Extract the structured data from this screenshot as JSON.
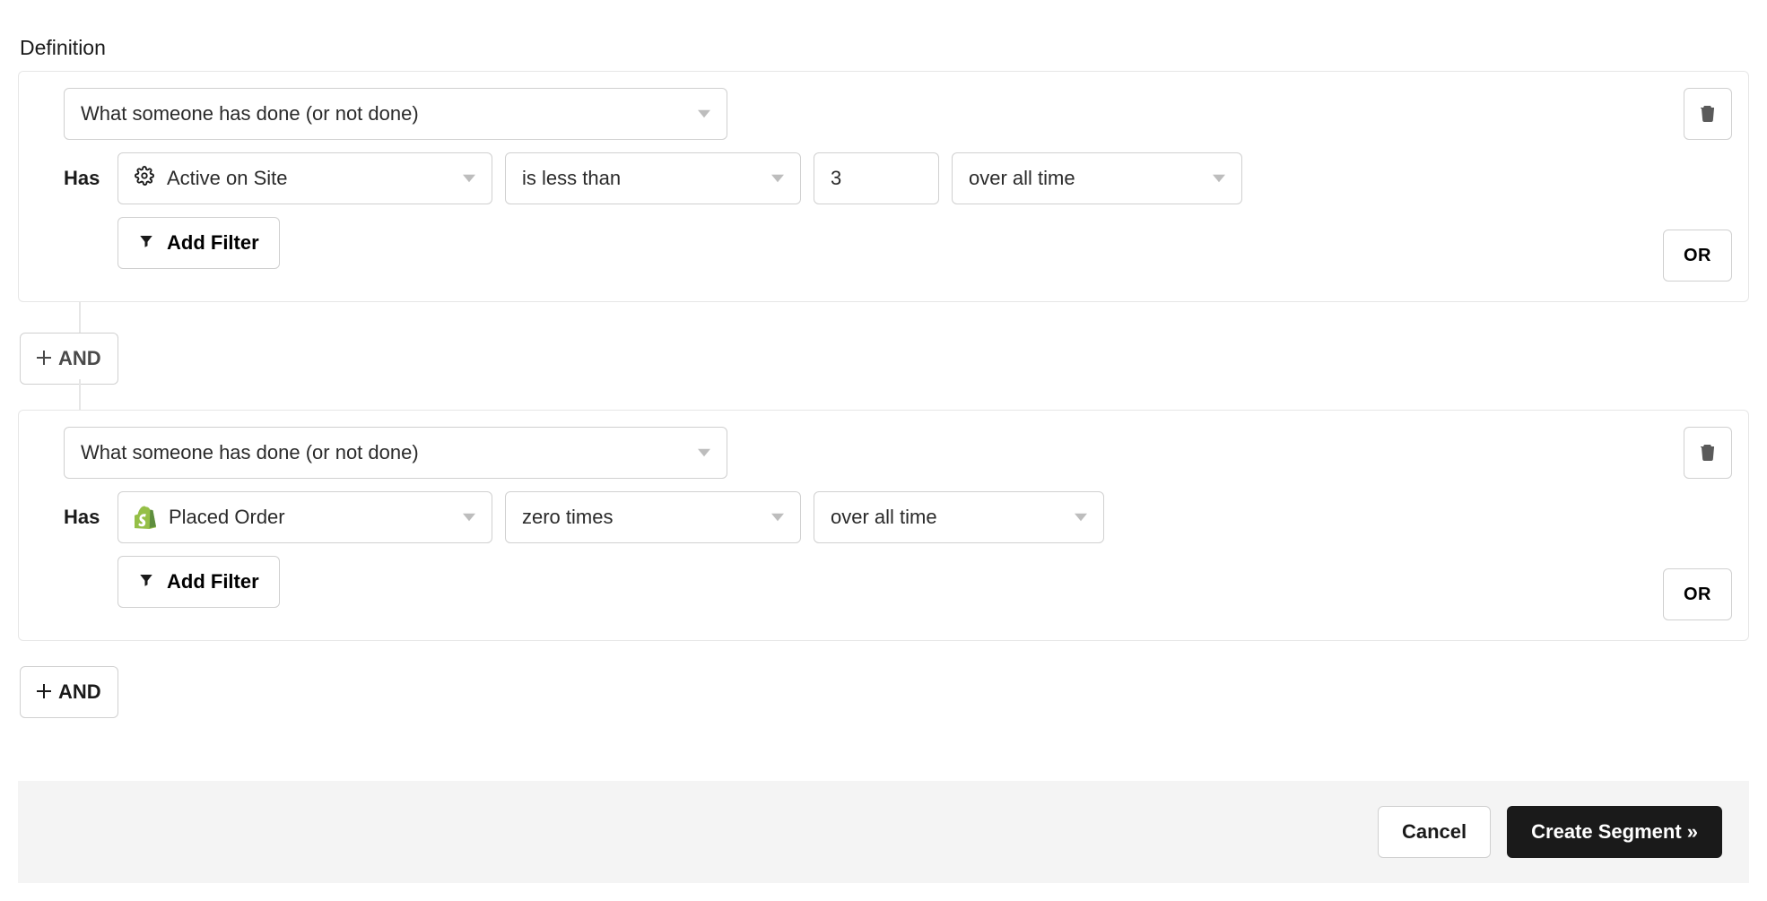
{
  "section_title": "Definition",
  "blocks": [
    {
      "condition_type": "What someone has done (or not done)",
      "has_label": "Has",
      "metric": {
        "icon": "gear",
        "label": "Active on Site"
      },
      "operator": "is less than",
      "value": "3",
      "timeframe": "over all time",
      "add_filter_label": "Add Filter",
      "or_label": "OR"
    },
    {
      "condition_type": "What someone has done (or not done)",
      "has_label": "Has",
      "metric": {
        "icon": "shopify",
        "label": "Placed Order"
      },
      "operator": "zero times",
      "timeframe": "over all time",
      "add_filter_label": "Add Filter",
      "or_label": "OR"
    }
  ],
  "connector_and_label": "AND",
  "add_and_label": "AND",
  "footer": {
    "cancel": "Cancel",
    "create": "Create Segment »"
  }
}
